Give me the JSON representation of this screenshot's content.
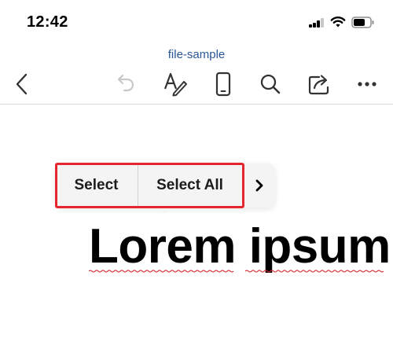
{
  "status_bar": {
    "time": "12:42"
  },
  "document": {
    "title": "file-sample",
    "body_text": "Lorem ipsum"
  },
  "toolbar": {
    "icons": [
      "back-icon",
      "undo-icon",
      "format-text-icon",
      "mobile-view-icon",
      "search-icon",
      "share-icon",
      "more-icon"
    ]
  },
  "context_menu": {
    "select_label": "Select",
    "select_all_label": "Select All",
    "more_glyph": "›"
  },
  "colors": {
    "title_link": "#2b5797",
    "highlight_border": "#e5262d",
    "spellcheck_underline": "#d62728",
    "menu_background": "#f4f4f4"
  }
}
